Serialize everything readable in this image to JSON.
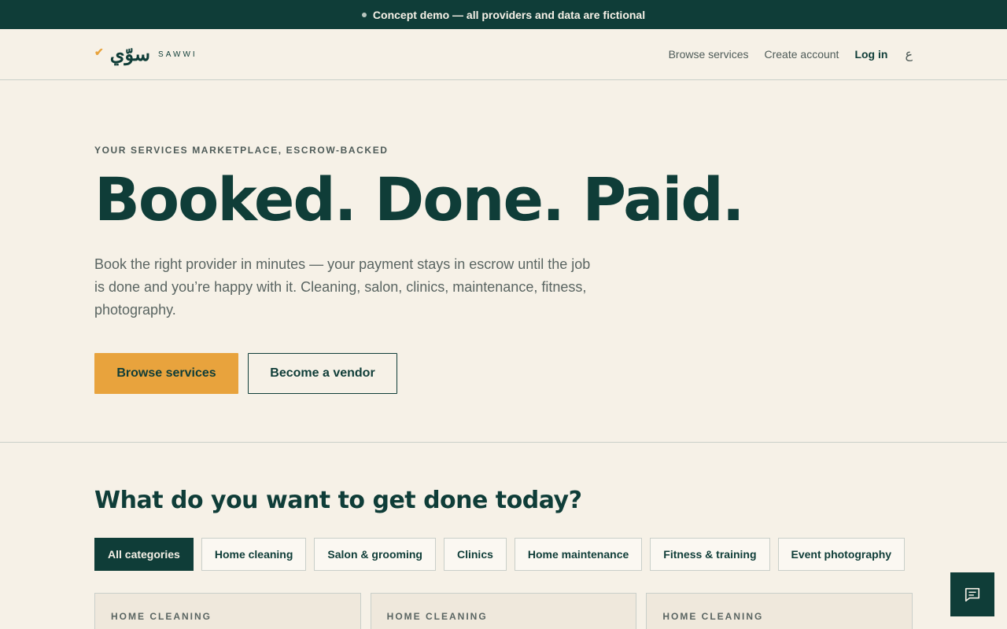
{
  "banner": {
    "text": "Concept demo — all providers and data are fictional"
  },
  "brand": {
    "arabic": "سوّي",
    "latin": "SAWWI"
  },
  "nav": {
    "browse": "Browse services",
    "create": "Create account",
    "login": "Log in",
    "lang": "ع"
  },
  "hero": {
    "eyebrow": "YOUR SERVICES MARKETPLACE, ESCROW-BACKED",
    "headline": "Booked. Done. Paid.",
    "lede": "Book the right provider in minutes — your payment stays in escrow until the job is done and you’re happy with it. Cleaning, salon, clinics, maintenance, fitness, photography.",
    "primary_cta": "Browse services",
    "secondary_cta": "Become a vendor"
  },
  "categories": {
    "heading": "What do you want to get done today?",
    "chips": [
      "All categories",
      "Home cleaning",
      "Salon & grooming",
      "Clinics",
      "Home maintenance",
      "Fitness & training",
      "Event photography"
    ],
    "active_index": 0
  },
  "cards": [
    {
      "category": "HOME CLEANING"
    },
    {
      "category": "HOME CLEANING"
    },
    {
      "category": "HOME CLEANING"
    }
  ],
  "colors": {
    "brand": "#0f3d38",
    "accent": "#e8a33d",
    "background": "#f6f1e7"
  },
  "icons": {
    "chat": "chat-bubble-icon",
    "logo_check": "double-check-icon"
  }
}
